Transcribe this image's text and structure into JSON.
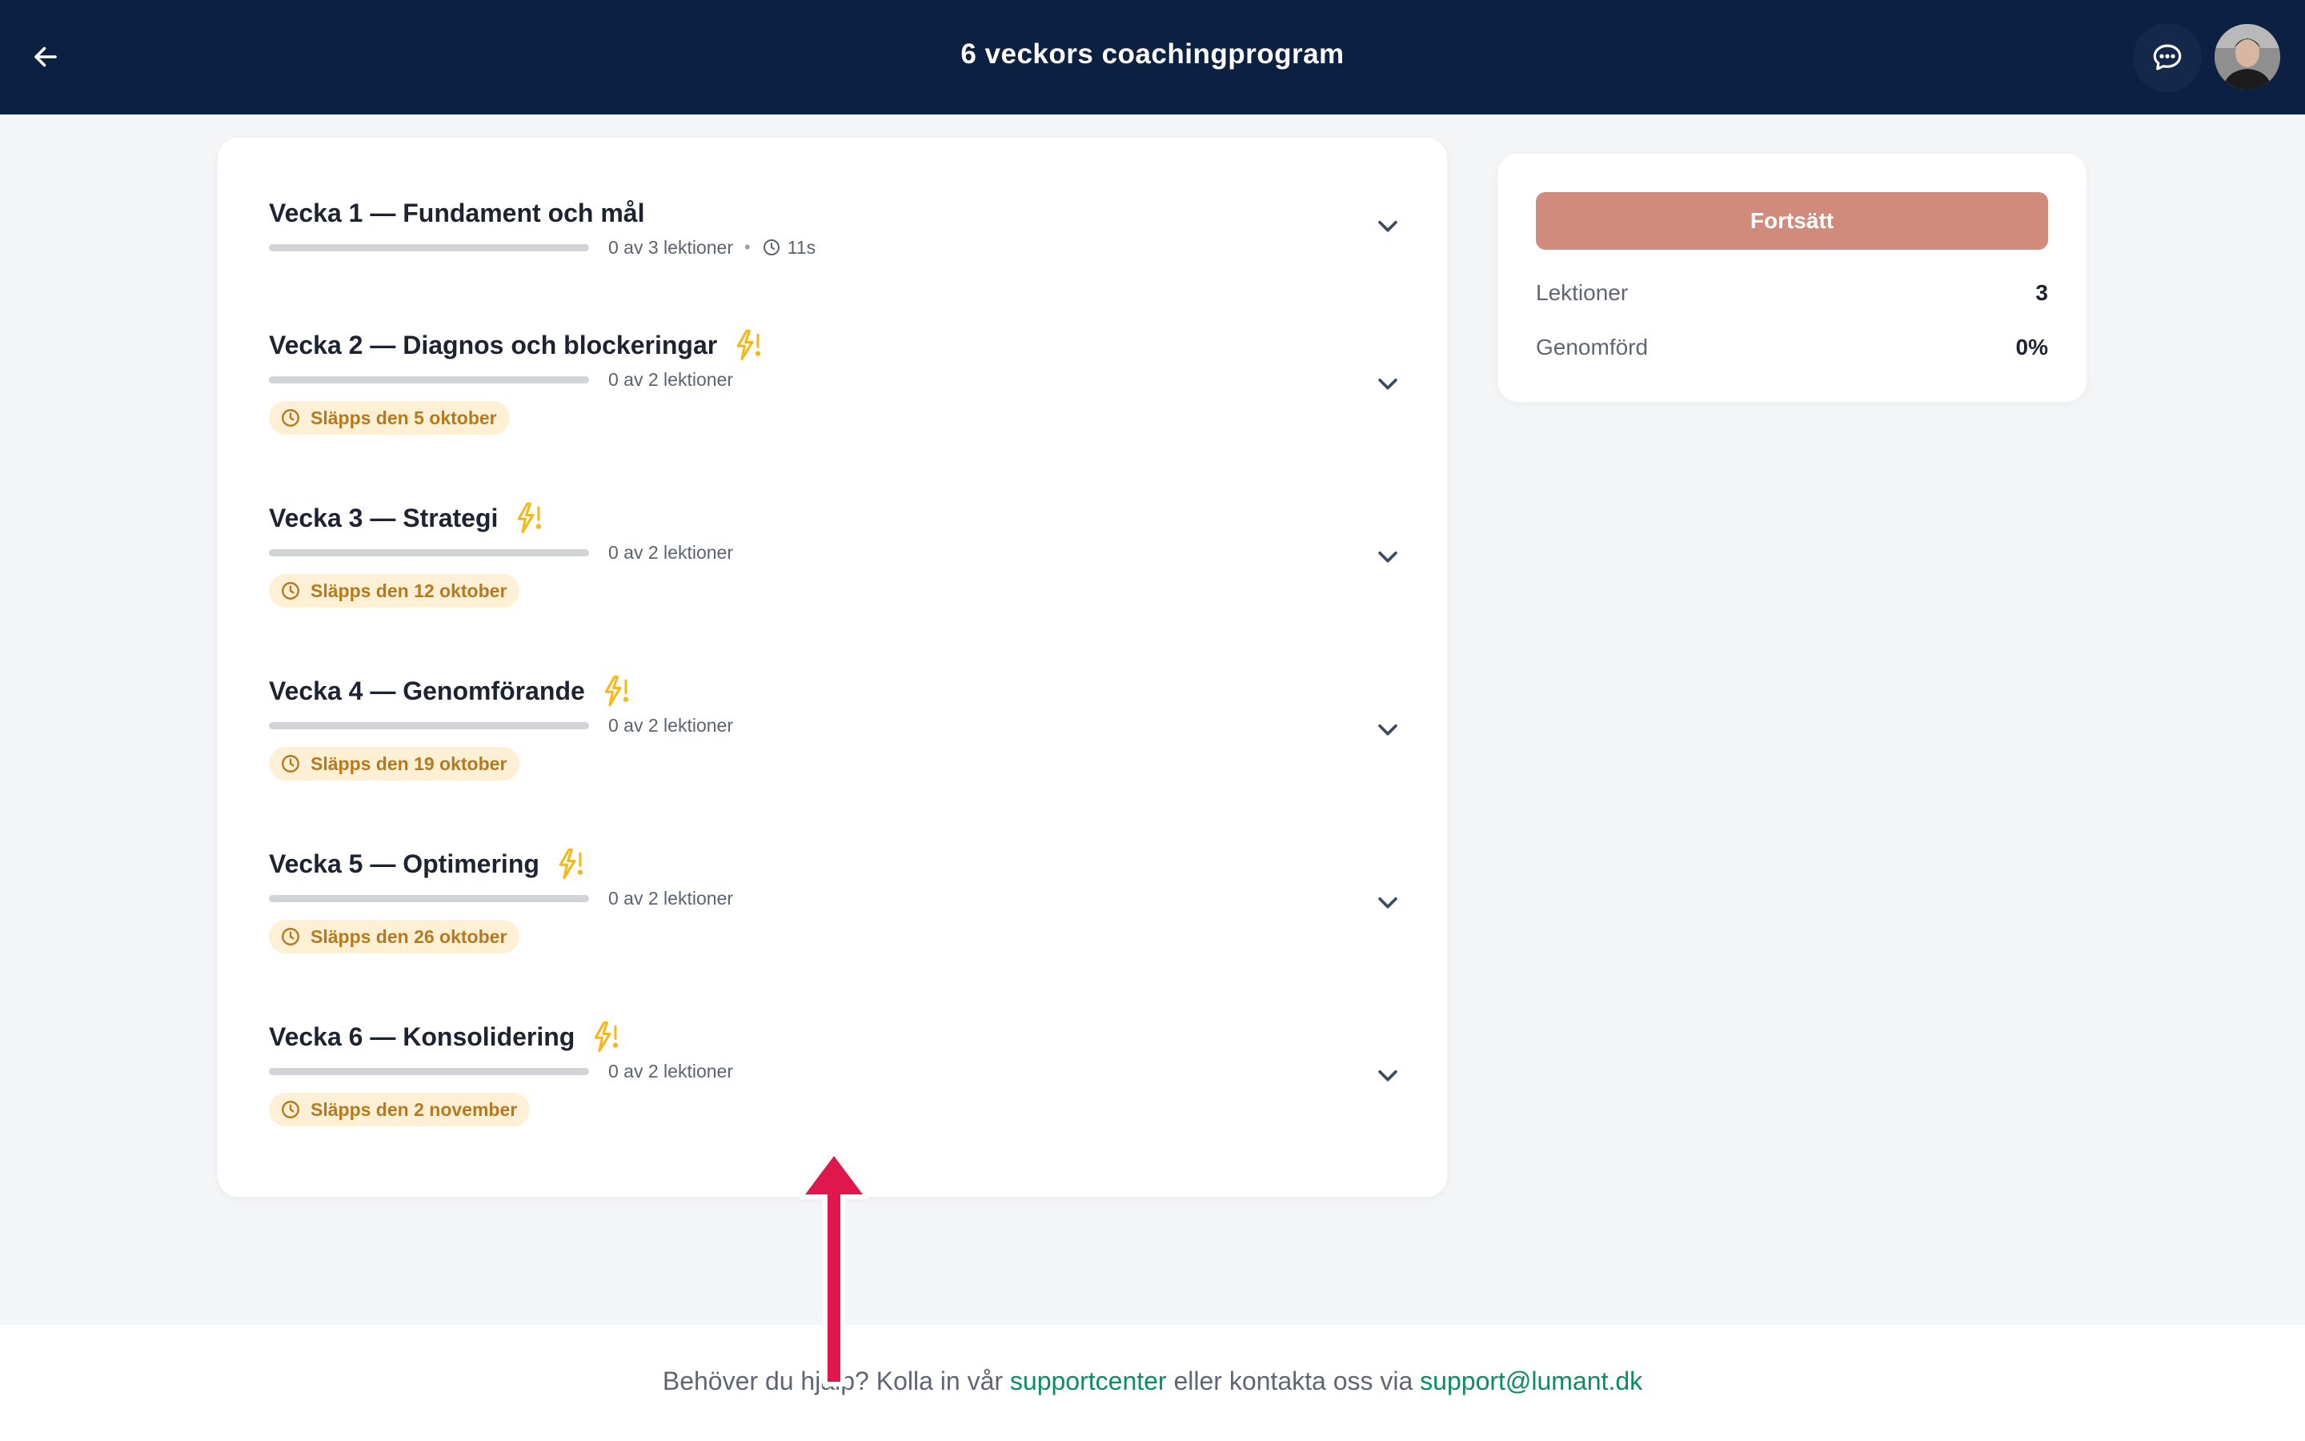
{
  "header": {
    "title": "6 veckors coachingprogram",
    "back_icon": "arrow-left-icon",
    "chat_icon": "chat-bubble-icon",
    "avatar_alt": "user avatar"
  },
  "weeks": [
    {
      "title": "Vecka 1 — Fundament och mål",
      "progress": 0,
      "lessons_text": "0 av 3 lektioner",
      "duration": "11s",
      "locked": false,
      "release": ""
    },
    {
      "title": "Vecka 2 — Diagnos och blockeringar",
      "progress": 0,
      "lessons_text": "0 av 2 lektioner",
      "locked": true,
      "release": "Släpps den 5 oktober"
    },
    {
      "title": "Vecka 3 — Strategi",
      "progress": 0,
      "lessons_text": "0 av 2 lektioner",
      "locked": true,
      "release": "Släpps den 12 oktober"
    },
    {
      "title": "Vecka 4 — Genomförande",
      "progress": 0,
      "lessons_text": "0 av 2 lektioner",
      "locked": true,
      "release": "Släpps den 19 oktober"
    },
    {
      "title": "Vecka 5 — Optimering",
      "progress": 0,
      "lessons_text": "0 av 2 lektioner",
      "locked": true,
      "release": "Släpps den 26 oktober"
    },
    {
      "title": "Vecka 6 — Konsolidering",
      "progress": 0,
      "lessons_text": "0 av 2 lektioner",
      "locked": true,
      "release": "Släpps den 2 november"
    }
  ],
  "sidebar": {
    "continue_label": "Fortsätt",
    "stats": [
      {
        "label": "Lektioner",
        "value": "3"
      },
      {
        "label": "Genomförd",
        "value": "0%"
      }
    ]
  },
  "footer": {
    "text_before": "Behöver du hjälp? Kolla in vår ",
    "support_link": "supportcenter",
    "text_middle": " eller kontakta oss via ",
    "email_link": "support@lumant.dk"
  },
  "colors": {
    "header_bg": "#0c2141",
    "accent_button": "#d18b7c",
    "badge_bg": "#fdf0d5",
    "badge_text": "#b7791f",
    "link": "#0b8f5a",
    "annotation_arrow": "#e0174c"
  }
}
